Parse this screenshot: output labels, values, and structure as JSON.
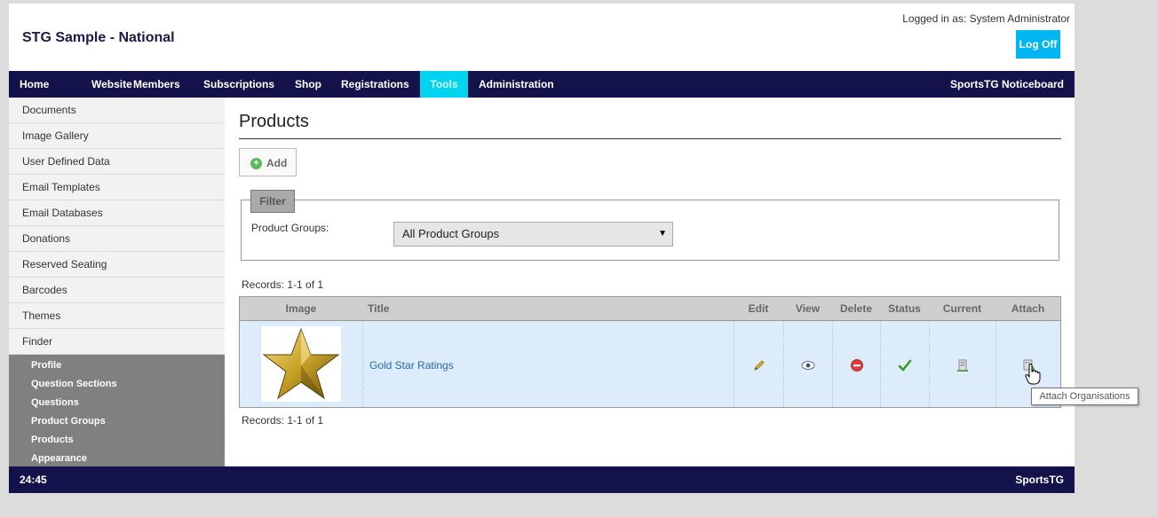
{
  "header": {
    "app_title": "STG Sample - National",
    "logged_in": "Logged in as: System Administrator",
    "logoff_label": "Log Off"
  },
  "navbar": {
    "items": [
      {
        "label": "Home"
      },
      {
        "label": "Website"
      },
      {
        "label": "Members"
      },
      {
        "label": "Subscriptions"
      },
      {
        "label": "Shop"
      },
      {
        "label": "Registrations"
      },
      {
        "label": "Tools",
        "active": true
      },
      {
        "label": "Administration"
      }
    ],
    "right_label": "SportsTG Noticeboard"
  },
  "sidebar": {
    "items": [
      {
        "label": "Documents"
      },
      {
        "label": "Image Gallery"
      },
      {
        "label": "User Defined Data"
      },
      {
        "label": "Email Templates"
      },
      {
        "label": "Email Databases"
      },
      {
        "label": "Donations"
      },
      {
        "label": "Reserved Seating"
      },
      {
        "label": "Barcodes"
      },
      {
        "label": "Themes"
      },
      {
        "label": "Finder"
      }
    ],
    "subitems": [
      {
        "label": "Profile"
      },
      {
        "label": "Question Sections"
      },
      {
        "label": "Questions"
      },
      {
        "label": "Product Groups"
      },
      {
        "label": "Products"
      },
      {
        "label": "Appearance"
      }
    ]
  },
  "main": {
    "title": "Products",
    "add_label": "Add",
    "filter": {
      "legend": "Filter",
      "label": "Product Groups:",
      "selected": "All Product Groups"
    },
    "records_top": "Records: 1-1 of 1",
    "records_bottom": "Records: 1-1 of 1",
    "table": {
      "columns": [
        "Image",
        "Title",
        "Edit",
        "View",
        "Delete",
        "Status",
        "Current",
        "Attach"
      ],
      "rows": [
        {
          "title": "Gold Star Ratings",
          "image_icon": "gold-star-image"
        }
      ]
    },
    "tooltip": "Attach Organisations"
  },
  "footer": {
    "left": "24:45",
    "right": "SportsTG"
  },
  "colors": {
    "nav_bg": "#13124a",
    "accent": "#00b6f0",
    "active_tab": "#00d4f0",
    "row_bg": "#dcecfb"
  }
}
